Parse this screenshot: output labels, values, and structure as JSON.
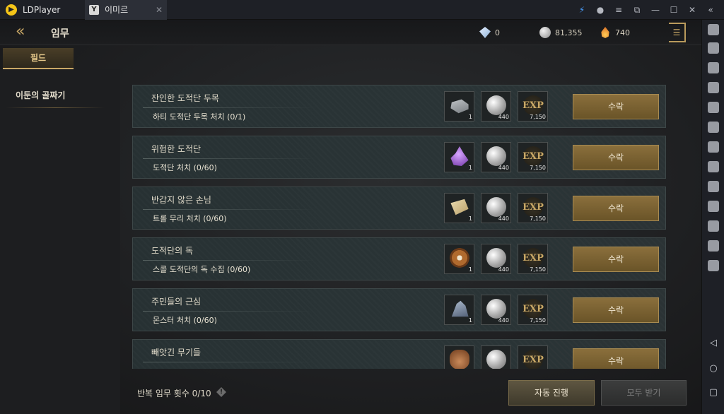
{
  "window": {
    "app_name": "LDPlayer",
    "tab_title": "이미르",
    "tab_icon_glyph": "Y"
  },
  "header": {
    "title": "임무",
    "currencies": [
      {
        "icon": "diamond-icon",
        "value": "0"
      },
      {
        "icon": "silver-coin-icon",
        "value": "81,355"
      },
      {
        "icon": "flame-gem-icon",
        "value": "740"
      }
    ]
  },
  "sidebar": {
    "tab_label": "필드",
    "items": [
      {
        "label": "이둔의 골짜기"
      }
    ]
  },
  "quests": [
    {
      "title": "잔인한 도적단 두목",
      "desc": "하티 도적단 두목 처치 (0/1)",
      "rewards": [
        {
          "icon": "silver-ingot-icon",
          "qty": "1"
        },
        {
          "icon": "silver-coin-icon",
          "qty": "440"
        },
        {
          "icon": "exp-icon",
          "qty": "7,150"
        }
      ],
      "button": "수락"
    },
    {
      "title": "위험한 도적단",
      "desc": "도적단 처치 (0/60)",
      "rewards": [
        {
          "icon": "purple-crystal-icon",
          "qty": "1"
        },
        {
          "icon": "silver-coin-icon",
          "qty": "440"
        },
        {
          "icon": "exp-icon",
          "qty": "7,150"
        }
      ],
      "button": "수락"
    },
    {
      "title": "반갑지 않은 손님",
      "desc": "트롤 무리 처치 (0/60)",
      "rewards": [
        {
          "icon": "scroll-icon",
          "qty": "1"
        },
        {
          "icon": "silver-coin-icon",
          "qty": "440"
        },
        {
          "icon": "exp-icon",
          "qty": "7,150"
        }
      ],
      "button": "수락"
    },
    {
      "title": "도적단의 독",
      "desc": "스콜 도적단의 독 수집 (0/60)",
      "rewards": [
        {
          "icon": "gear-icon",
          "qty": "1"
        },
        {
          "icon": "silver-coin-icon",
          "qty": "440"
        },
        {
          "icon": "exp-icon",
          "qty": "7,150"
        }
      ],
      "button": "수락"
    },
    {
      "title": "주민들의 근심",
      "desc": "몬스터 처치 (0/60)",
      "rewards": [
        {
          "icon": "ore-icon",
          "qty": "1"
        },
        {
          "icon": "silver-coin-icon",
          "qty": "440"
        },
        {
          "icon": "exp-icon",
          "qty": "7,150"
        }
      ],
      "button": "수락"
    },
    {
      "title": "빼앗긴 무기들",
      "desc": "",
      "rewards": [
        {
          "icon": "pouch-icon",
          "qty": ""
        },
        {
          "icon": "silver-coin-icon",
          "qty": ""
        },
        {
          "icon": "exp-icon",
          "qty": ""
        }
      ],
      "button": "수락"
    }
  ],
  "exp_glyph": "EXP",
  "footer": {
    "repeat_count": "반복 임무 횟수 0/10",
    "info_glyph": "!",
    "auto_button": "자동 진행",
    "receive_all_button": "모두 받기"
  }
}
